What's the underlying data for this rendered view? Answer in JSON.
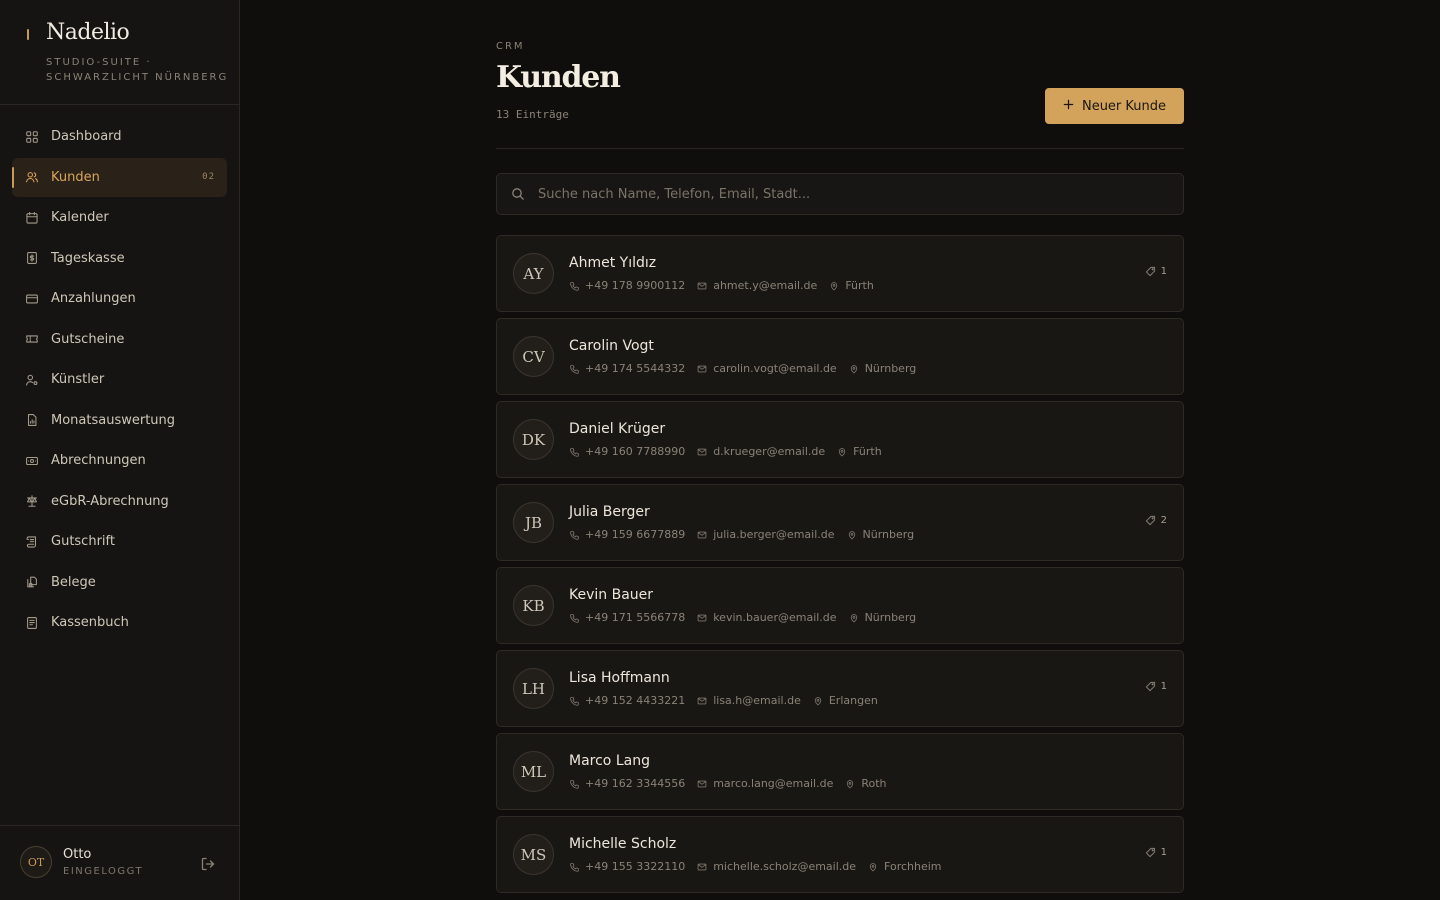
{
  "brand": {
    "title": "Nadelio",
    "subtitle": "STUDIO-SUITE · SCHWARZLICHT NÜRNBERG",
    "accent": "#c99a56"
  },
  "sidebar": {
    "items": [
      {
        "label": "Dashboard",
        "icon": "dashboard-icon",
        "active": false,
        "badge": ""
      },
      {
        "label": "Kunden",
        "icon": "users-icon",
        "active": true,
        "badge": "02"
      },
      {
        "label": "Kalender",
        "icon": "calendar-icon",
        "active": false,
        "badge": ""
      },
      {
        "label": "Tageskasse",
        "icon": "receipt-icon",
        "active": false,
        "badge": ""
      },
      {
        "label": "Anzahlungen",
        "icon": "credit-card-icon",
        "active": false,
        "badge": ""
      },
      {
        "label": "Gutscheine",
        "icon": "ticket-icon",
        "active": false,
        "badge": ""
      },
      {
        "label": "Künstler",
        "icon": "artist-icon",
        "active": false,
        "badge": ""
      },
      {
        "label": "Monatsauswertung",
        "icon": "report-icon",
        "active": false,
        "badge": ""
      },
      {
        "label": "Abrechnungen",
        "icon": "banknote-icon",
        "active": false,
        "badge": ""
      },
      {
        "label": "eGbR-Abrechnung",
        "icon": "scale-icon",
        "active": false,
        "badge": ""
      },
      {
        "label": "Gutschrift",
        "icon": "scroll-icon",
        "active": false,
        "badge": ""
      },
      {
        "label": "Belege",
        "icon": "documents-icon",
        "active": false,
        "badge": ""
      },
      {
        "label": "Kassenbuch",
        "icon": "book-icon",
        "active": false,
        "badge": ""
      }
    ]
  },
  "user": {
    "initials": "OT",
    "name": "Otto",
    "status": "EINGELOGGT"
  },
  "header": {
    "eyebrow": "CRM",
    "title": "Kunden",
    "count": "13 Einträge",
    "new_button": "Neuer Kunde"
  },
  "search": {
    "placeholder": "Suche nach Name, Telefon, Email, Stadt..."
  },
  "customers": [
    {
      "initials": "AY",
      "name": "Ahmet Yıldız",
      "phone": "+49 178 9900112",
      "email": "ahmet.y@email.de",
      "city": "Fürth",
      "tags": "1"
    },
    {
      "initials": "CV",
      "name": "Carolin Vogt",
      "phone": "+49 174 5544332",
      "email": "carolin.vogt@email.de",
      "city": "Nürnberg",
      "tags": ""
    },
    {
      "initials": "DK",
      "name": "Daniel Krüger",
      "phone": "+49 160 7788990",
      "email": "d.krueger@email.de",
      "city": "Fürth",
      "tags": ""
    },
    {
      "initials": "JB",
      "name": "Julia Berger",
      "phone": "+49 159 6677889",
      "email": "julia.berger@email.de",
      "city": "Nürnberg",
      "tags": "2"
    },
    {
      "initials": "KB",
      "name": "Kevin Bauer",
      "phone": "+49 171 5566778",
      "email": "kevin.bauer@email.de",
      "city": "Nürnberg",
      "tags": ""
    },
    {
      "initials": "LH",
      "name": "Lisa Hoffmann",
      "phone": "+49 152 4433221",
      "email": "lisa.h@email.de",
      "city": "Erlangen",
      "tags": "1"
    },
    {
      "initials": "ML",
      "name": "Marco Lang",
      "phone": "+49 162 3344556",
      "email": "marco.lang@email.de",
      "city": "Roth",
      "tags": ""
    },
    {
      "initials": "MS",
      "name": "Michelle Scholz",
      "phone": "+49 155 3322110",
      "email": "michelle.scholz@email.de",
      "city": "Forchheim",
      "tags": "1"
    }
  ]
}
